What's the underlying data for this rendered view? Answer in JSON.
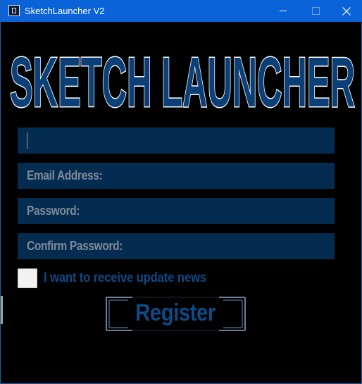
{
  "window": {
    "title": "SketchLauncher V2"
  },
  "logo": {
    "text": "SKETCH LAUNCHER"
  },
  "form": {
    "username_value": "",
    "email_placeholder": "Email Address:",
    "password_placeholder": "Password:",
    "confirm_placeholder": "Confirm Password:",
    "newsletter_label": "I want to receive update news",
    "newsletter_checked": false,
    "register_label": "Register"
  },
  "colors": {
    "titlebar": "#0a63d8",
    "background": "#000000",
    "field_bg": "#042b50",
    "placeholder_text": "#7d8a99",
    "accent_text": "#0d4a86",
    "logo_fill": "#0b3f78",
    "logo_stroke": "#ffffff"
  },
  "icons": {
    "app": "app-icon",
    "minimize": "minimize-icon",
    "maximize": "maximize-icon",
    "close": "close-icon"
  }
}
